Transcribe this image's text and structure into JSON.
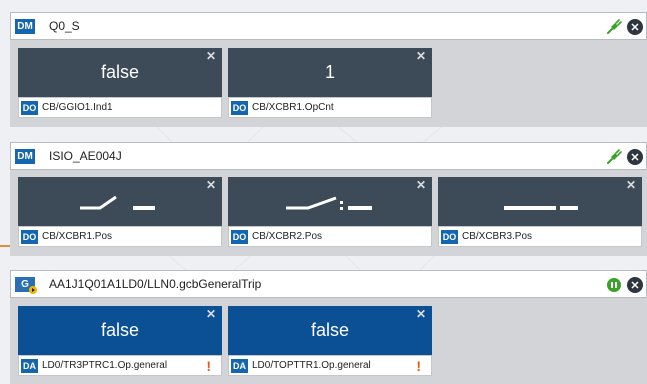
{
  "colors": {
    "accent_blue": "#1566b0",
    "tile_dark": "#3d4a57",
    "tile_blue": "#0b4f94",
    "warning": "#e8581c",
    "connected_green": "#3aa12b"
  },
  "panels": [
    {
      "type_badge": "DM",
      "title": "Q0_S",
      "status_icon": "connected-plug-icon",
      "tiles": [
        {
          "value": "false",
          "badge": "DO",
          "label": "CB/GGIO1.Ind1"
        },
        {
          "value": "1",
          "badge": "DO",
          "label": "CB/XCBR1.OpCnt"
        }
      ]
    },
    {
      "type_badge": "DM",
      "title": "ISIO_AE004J",
      "status_icon": "connected-plug-icon",
      "tiles": [
        {
          "badge": "DO",
          "label": "CB/XCBR1.Pos",
          "switch_state": "open"
        },
        {
          "badge": "DO",
          "label": "CB/XCBR2.Pos",
          "switch_state": "open-moving"
        },
        {
          "badge": "DO",
          "label": "CB/XCBR3.Pos",
          "switch_state": "closed"
        }
      ]
    },
    {
      "type_badge": "G",
      "title": "AA1J1Q01A1LD0/LLN0.gcbGeneralTrip",
      "status_icon": "goose-subscription-icon",
      "tiles": [
        {
          "value": "false",
          "badge": "DA",
          "label": "LD0/TR3PTRC1.Op.general",
          "warning": "!"
        },
        {
          "value": "false",
          "badge": "DA",
          "label": "LD0/TOPTTR1.Op.general",
          "warning": "!"
        }
      ]
    }
  ]
}
